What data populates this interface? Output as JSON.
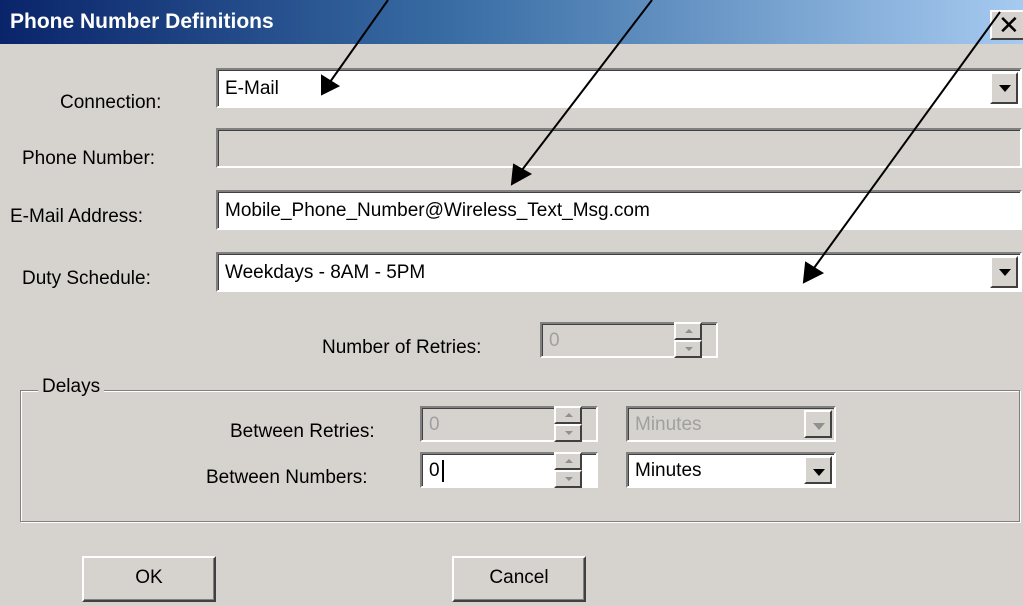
{
  "window": {
    "title": "Phone Number Definitions",
    "close_label": "✕"
  },
  "form": {
    "connection_label": "Connection:",
    "connection_value": "E-Mail",
    "phone_label": "Phone Number:",
    "phone_value": "",
    "email_label": "E-Mail Address:",
    "email_value": "Mobile_Phone_Number@Wireless_Text_Msg.com",
    "duty_label": "Duty Schedule:",
    "duty_value": "Weekdays - 8AM - 5PM",
    "retries_label": "Number of Retries:",
    "retries_value": "0"
  },
  "delays": {
    "legend": "Delays",
    "between_retries_label": "Between Retries:",
    "between_retries_value": "0",
    "between_retries_unit": "Minutes",
    "between_numbers_label": "Between Numbers:",
    "between_numbers_value": "0",
    "between_numbers_unit": "Minutes"
  },
  "buttons": {
    "ok": "OK",
    "cancel": "Cancel"
  },
  "colors": {
    "titlebar_start": "#0a246a",
    "titlebar_end": "#a6caf0",
    "face": "#d6d3ce"
  }
}
